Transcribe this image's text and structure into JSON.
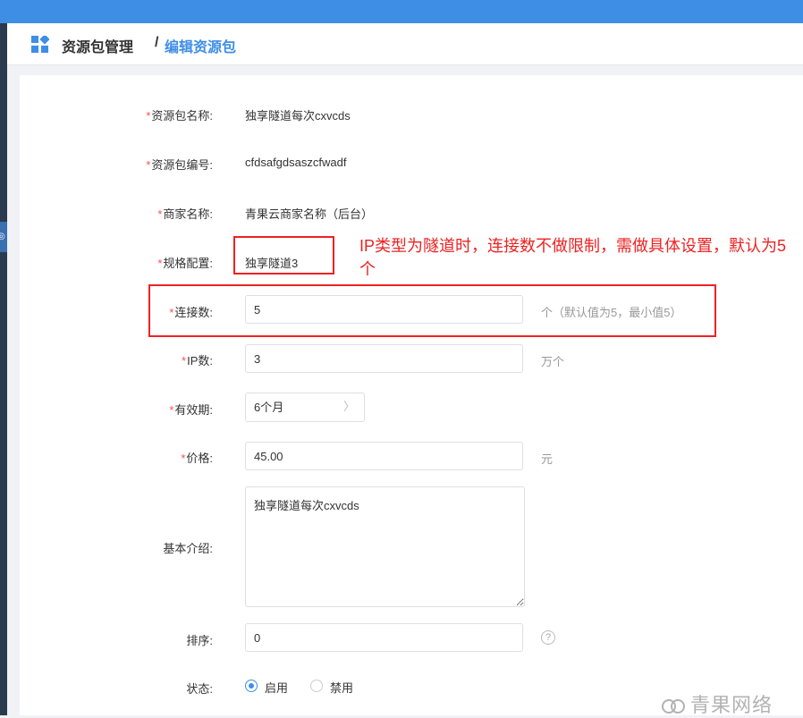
{
  "breadcrumb": {
    "main": "资源包管理",
    "separator": "/",
    "current": "编辑资源包"
  },
  "form": {
    "name": {
      "label": "资源包名称:",
      "required": "*",
      "value": "独享隧道每次cxvcds"
    },
    "code": {
      "label": "资源包编号:",
      "required": "*",
      "value": "cfdsafgdsaszcfwadf"
    },
    "merchant": {
      "label": "商家名称:",
      "required": "*",
      "value": "青果云商家名称（后台）"
    },
    "spec": {
      "label": "规格配置:",
      "required": "*",
      "value": "独享隧道3"
    },
    "connections": {
      "label": "连接数:",
      "required": "*",
      "value": "5",
      "suffix": "个（默认值为5，最小值5）"
    },
    "ip_count": {
      "label": "IP数:",
      "required": "*",
      "value": "3",
      "suffix": "万个"
    },
    "validity": {
      "label": "有效期:",
      "required": "*",
      "value": "6个月",
      "chevron": "〉"
    },
    "price": {
      "label": "价格:",
      "required": "*",
      "value": "45.00",
      "suffix": "元"
    },
    "intro": {
      "label": "基本介绍:",
      "value": "独享隧道每次cxvcds"
    },
    "sort": {
      "label": "排序:",
      "value": "0",
      "help_icon": "?"
    },
    "status": {
      "label": "状态:",
      "options": [
        "启用",
        "禁用"
      ],
      "selected": "启用"
    }
  },
  "annotation": {
    "text": "IP类型为隧道时，连接数不做限制，需做具体设置，默认为5个",
    "color": "#e22222"
  },
  "watermark": "青果网络",
  "colors": {
    "accent": "#3e8ee6",
    "required": "#ff4d4f",
    "annotation": "#e22222"
  }
}
